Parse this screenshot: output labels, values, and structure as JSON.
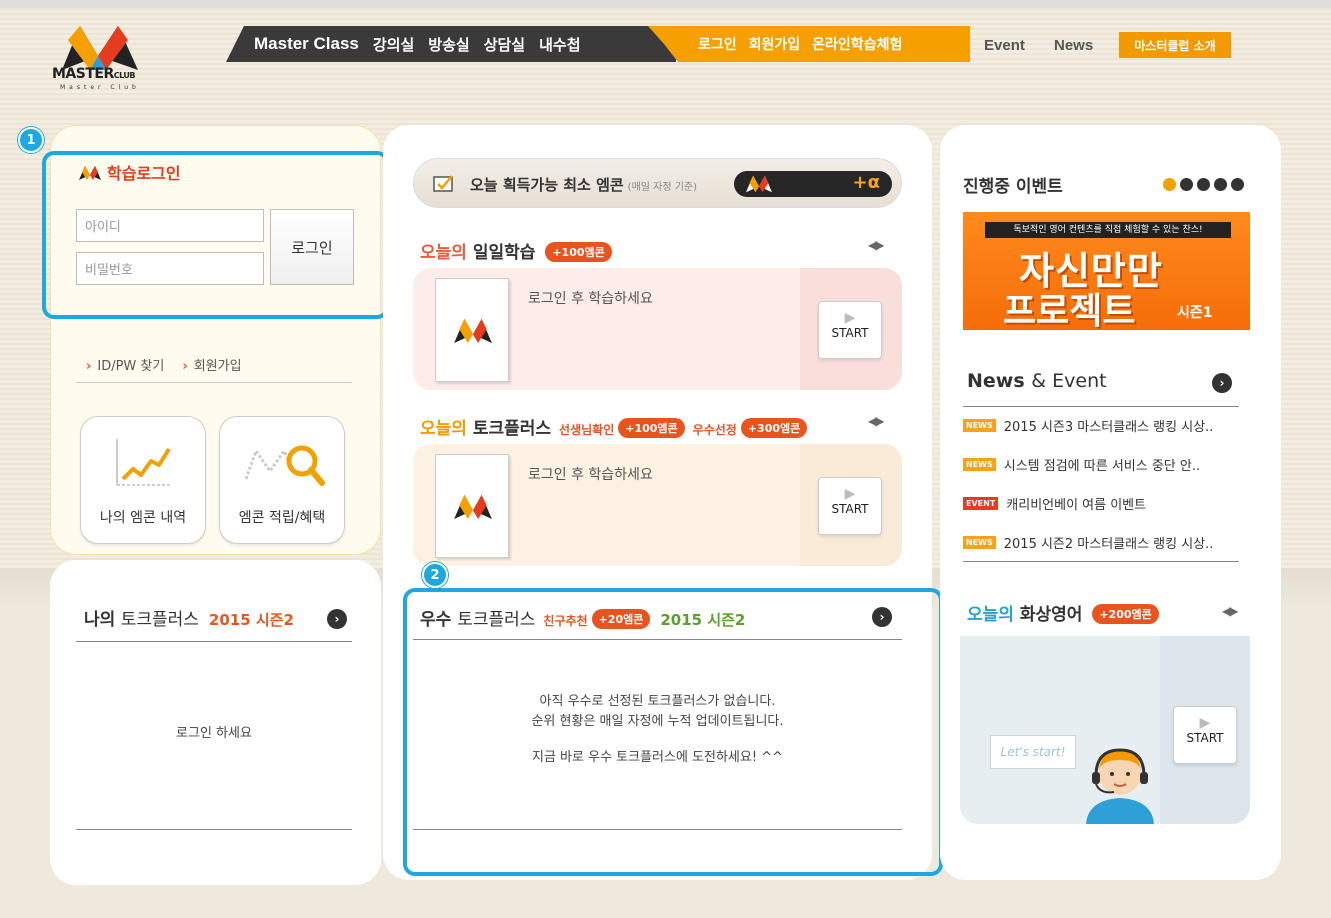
{
  "logo": {
    "main": "MASTER",
    "small": "CLUB",
    "sub": "Master Club"
  },
  "nav": {
    "brand": "Master Class",
    "dark_items": [
      "강의실",
      "방송실",
      "상담실",
      "내수첩"
    ],
    "orange_items": [
      "로그인",
      "회원가입",
      "온라인학습체험"
    ],
    "event": "Event",
    "news": "News",
    "club_intro": "마스터클럽 소개"
  },
  "markers": {
    "one": "1",
    "two": "2"
  },
  "login": {
    "title": "학습로그인",
    "id_placeholder": "아이디",
    "pw_placeholder": "비밀번호",
    "button": "로그인",
    "find": "ID/PW 찾기",
    "join": "회원가입",
    "card1": "나의 엠콘 내역",
    "card2": "엠콘 적립/혜택"
  },
  "my_talk": {
    "title_bold": "나의",
    "title_rest": "토크플러스",
    "season": "2015 시즌2",
    "message": "로그인 하세요"
  },
  "center": {
    "elcon_text": "오늘 획득가능 최소 엠콘",
    "elcon_note": "(매일 자정 기준)",
    "elcon_alpha": "+α",
    "daily_prefix": "오늘의",
    "daily_title": "일일학습",
    "daily_badge": "+100엠콘",
    "talk_prefix": "오늘의",
    "talk_title": "토크플러스",
    "talk_note1": "선생님확인",
    "talk_badge1": "+100엠콘",
    "talk_note2": "우수선정",
    "talk_badge2": "+300엠콘",
    "study_msg": "로그인 후 학습하세요",
    "start": "START",
    "best_bold": "우수",
    "best_rest": "토크플러스",
    "best_note": "친구추천",
    "best_badge": "+20엠콘",
    "best_season": "2015 시즌2",
    "best_msg1": "아직 우수로 선정된 토크플러스가 없습니다.",
    "best_msg2": "순위 현황은 매일 자정에 누적 업데이트됩니다.",
    "best_msg3": "지금 바로 우수 토크플러스에 도전하세요! ^^"
  },
  "right": {
    "event_title": "진행중 이벤트",
    "banner_strip": "독보적인 영어 컨텐츠를 직접 체험할 수 있는 찬스!",
    "banner_big1": "자신만만",
    "banner_big2": "프로젝트",
    "banner_season": "시즌1",
    "news_title_a": "News",
    "news_title_b": "& Event",
    "news": [
      {
        "tag": "NEWS",
        "text": "2015 시즌3 마스터클래스 랭킹 시상.."
      },
      {
        "tag": "NEWS",
        "text": "시스템 점검에 따른 서비스 중단 안.."
      },
      {
        "tag": "EVENT",
        "text": "캐리비언베이 여름 이벤트"
      },
      {
        "tag": "NEWS",
        "text": "2015 시즌2 마스터클래스 랭킹 시상.."
      }
    ],
    "video_prefix": "오늘의",
    "video_title": "화상영어",
    "video_badge": "+200엠콘",
    "lets_start": "Let's start!",
    "start": "START"
  },
  "colors": {
    "accent_blue": "#1fa8e0",
    "accent_orange": "#f5a000",
    "badge_red": "#e9531e"
  }
}
